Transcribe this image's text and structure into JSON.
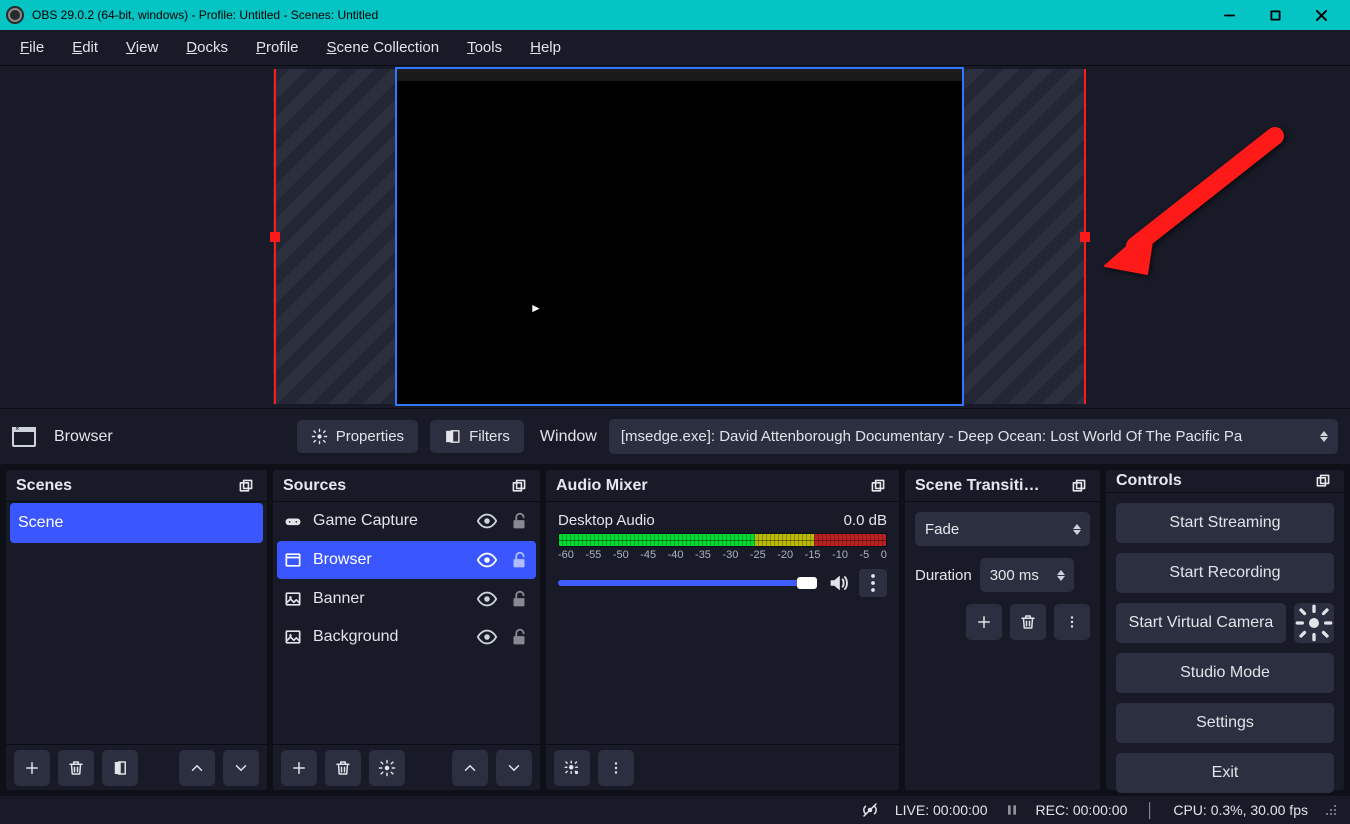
{
  "title": "OBS 29.0.2 (64-bit, windows) - Profile: Untitled - Scenes: Untitled",
  "menu": {
    "file": "File",
    "edit": "Edit",
    "view": "View",
    "docks": "Docks",
    "profile": "Profile",
    "scene_collection": "Scene Collection",
    "tools": "Tools",
    "help": "Help"
  },
  "source_toolbar": {
    "label": "Browser",
    "properties": "Properties",
    "filters": "Filters",
    "window_label": "Window",
    "window_value": "[msedge.exe]: David Attenborough Documentary - Deep Ocean: Lost World Of The Pacific Pa"
  },
  "scenes": {
    "title": "Scenes",
    "items": [
      "Scene"
    ]
  },
  "sources": {
    "title": "Sources",
    "items": [
      {
        "name": "Game Capture",
        "icon": "gamepad",
        "selected": false
      },
      {
        "name": "Browser",
        "icon": "window",
        "selected": true
      },
      {
        "name": "Banner",
        "icon": "image",
        "selected": false
      },
      {
        "name": "Background",
        "icon": "image",
        "selected": false
      }
    ]
  },
  "mixer": {
    "title": "Audio Mixer",
    "channel": "Desktop Audio",
    "level": "0.0 dB",
    "scale": [
      "-60",
      "-55",
      "-50",
      "-45",
      "-40",
      "-35",
      "-30",
      "-25",
      "-20",
      "-15",
      "-10",
      "-5",
      "0"
    ]
  },
  "transitions": {
    "title": "Scene Transiti…",
    "selected": "Fade",
    "duration_label": "Duration",
    "duration_value": "300 ms"
  },
  "controls": {
    "title": "Controls",
    "start_streaming": "Start Streaming",
    "start_recording": "Start Recording",
    "start_virtual_camera": "Start Virtual Camera",
    "studio_mode": "Studio Mode",
    "settings": "Settings",
    "exit": "Exit"
  },
  "status": {
    "live": "LIVE: 00:00:00",
    "rec": "REC: 00:00:00",
    "cpu": "CPU: 0.3%, 30.00 fps"
  }
}
